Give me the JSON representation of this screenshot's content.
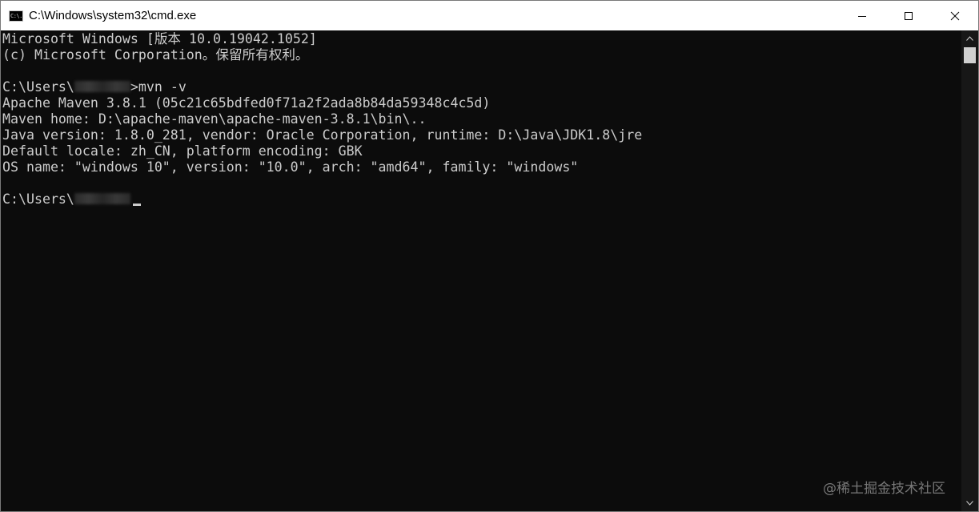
{
  "window": {
    "title": "C:\\Windows\\system32\\cmd.exe",
    "icon_label": "C:\\."
  },
  "console": {
    "lines": [
      {
        "text": "Microsoft Windows [版本 10.0.19042.1052]"
      },
      {
        "text": "(c) Microsoft Corporation。保留所有权利。"
      },
      {
        "text": ""
      },
      {
        "prompt_prefix": "C:\\Users\\",
        "prompt_suffix": ">mvn -v"
      },
      {
        "text": "Apache Maven 3.8.1 (05c21c65bdfed0f71a2f2ada8b84da59348c4c5d)"
      },
      {
        "text": "Maven home: D:\\apache-maven\\apache-maven-3.8.1\\bin\\.."
      },
      {
        "text": "Java version: 1.8.0_281, vendor: Oracle Corporation, runtime: D:\\Java\\JDK1.8\\jre"
      },
      {
        "text": "Default locale: zh_CN, platform encoding: GBK"
      },
      {
        "text": "OS name: \"windows 10\", version: \"10.0\", arch: \"amd64\", family: \"windows\""
      },
      {
        "text": ""
      },
      {
        "prompt_prefix": "C:\\Users\\",
        "prompt_suffix": ""
      }
    ]
  },
  "watermark": "@稀土掘金技术社区",
  "colors": {
    "console_bg": "#0c0c0c",
    "console_text": "#cccccc",
    "titlebar_bg": "#ffffff"
  },
  "icons": {
    "minimize": "minimize-icon",
    "maximize": "maximize-icon",
    "close": "close-icon",
    "scroll_up": "chevron-up-icon",
    "scroll_down": "chevron-down-icon"
  }
}
